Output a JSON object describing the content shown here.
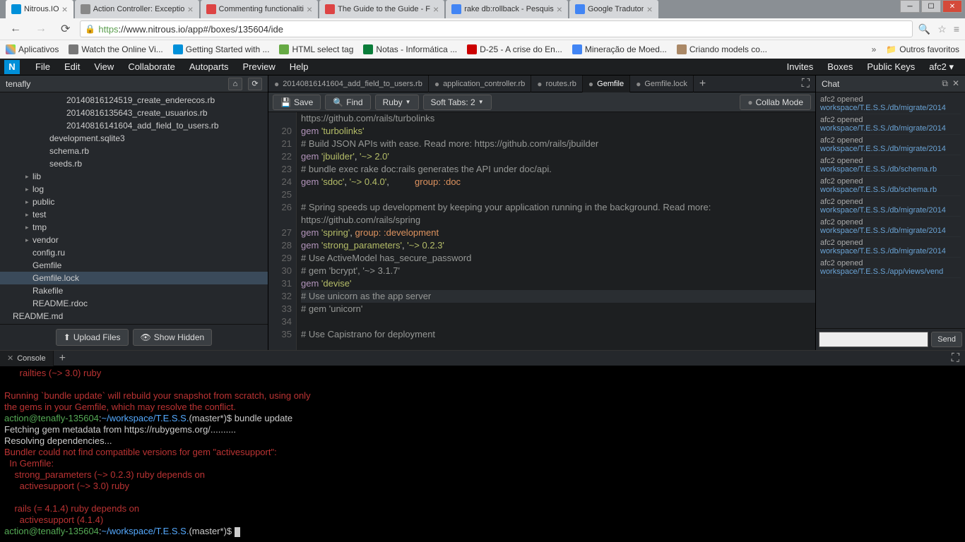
{
  "browser": {
    "tabs": [
      {
        "title": "Nitrous.IO",
        "favicon": "#0090d9",
        "active": true
      },
      {
        "title": "Action Controller: Exceptio",
        "favicon": "#888"
      },
      {
        "title": "Commenting functionaliti",
        "favicon": "#d44"
      },
      {
        "title": "The Guide to the Guide - F",
        "favicon": "#d44"
      },
      {
        "title": "rake db:rollback - Pesquis",
        "favicon": "#4285f4"
      },
      {
        "title": "Google Tradutor",
        "favicon": "#4285f4"
      }
    ],
    "url_https": "https",
    "url_rest": "://www.nitrous.io/app#/boxes/135604/ide",
    "bookmarks_label": "Aplicativos",
    "bookmarks": [
      {
        "label": "Watch the Online Vi...",
        "color": "#777"
      },
      {
        "label": "Getting Started with ...",
        "color": "#0090d9"
      },
      {
        "label": "HTML select tag",
        "color": "#6a4"
      },
      {
        "label": "Notas - Informática ...",
        "color": "#0a7d3a"
      },
      {
        "label": "D-25 - A crise do En...",
        "color": "#c00"
      },
      {
        "label": "Mineração de Moed...",
        "color": "#4285f4"
      },
      {
        "label": "Criando models co...",
        "color": "#a86"
      }
    ],
    "other_bookmarks": "Outros favoritos"
  },
  "menubar": {
    "items": [
      "File",
      "Edit",
      "View",
      "Collaborate",
      "Autoparts",
      "Preview",
      "Help"
    ],
    "right": [
      "Invites",
      "Boxes",
      "Public Keys",
      "afc2 ▾"
    ]
  },
  "sidebar": {
    "title": "tenafly",
    "tree": [
      {
        "label": "20140816124519_create_enderecos.rb",
        "depth": 3
      },
      {
        "label": "20140816135643_create_usuarios.rb",
        "depth": 3
      },
      {
        "label": "20140816141604_add_field_to_users.rb",
        "depth": 3
      },
      {
        "label": "development.sqlite3",
        "depth": 2
      },
      {
        "label": "schema.rb",
        "depth": 2
      },
      {
        "label": "seeds.rb",
        "depth": 2
      },
      {
        "label": "lib",
        "depth": 1,
        "folder": true
      },
      {
        "label": "log",
        "depth": 1,
        "folder": true
      },
      {
        "label": "public",
        "depth": 1,
        "folder": true
      },
      {
        "label": "test",
        "depth": 1,
        "folder": true
      },
      {
        "label": "tmp",
        "depth": 1,
        "folder": true
      },
      {
        "label": "vendor",
        "depth": 1,
        "folder": true
      },
      {
        "label": "config.ru",
        "depth": 1
      },
      {
        "label": "Gemfile",
        "depth": 1
      },
      {
        "label": "Gemfile.lock",
        "depth": 1,
        "selected": true
      },
      {
        "label": "Rakefile",
        "depth": 1
      },
      {
        "label": "README.rdoc",
        "depth": 1
      },
      {
        "label": "README.md",
        "depth": 0
      }
    ],
    "upload": "Upload Files",
    "show_hidden": "Show Hidden"
  },
  "editor": {
    "tabs": [
      {
        "label": "20140816141604_add_field_to_users.rb",
        "dirty": true
      },
      {
        "label": "application_controller.rb",
        "dirty": true
      },
      {
        "label": "routes.rb",
        "dirty": true
      },
      {
        "label": "Gemfile",
        "dirty": true,
        "active": true
      },
      {
        "label": "Gemfile.lock",
        "dirty": true
      }
    ],
    "save": "Save",
    "find": "Find",
    "lang": "Ruby",
    "softtabs": "Soft Tabs: 2",
    "collab": "Collab Mode",
    "gutter": [
      "",
      "20",
      "21",
      "22",
      "23",
      "24",
      "25",
      "26",
      "",
      "27",
      "28",
      "29",
      "30",
      "31",
      "32",
      "33",
      "34",
      "35"
    ],
    "code_html": [
      "<span class='c-cm'>https://github.com/rails/turbolinks</span>",
      "<span class='c-kw'>gem</span> <span class='c-str'>'turbolinks'</span>",
      "<span class='c-cm'># Build JSON APIs with ease. Read more: https://github.com/rails/jbuilder</span>",
      "<span class='c-kw'>gem</span> <span class='c-str'>'jbuilder'</span>, <span class='c-str'>'~> 2.0'</span>",
      "<span class='c-cm'># bundle exec rake doc:rails generates the API under doc/api.</span>",
      "<span class='c-kw'>gem</span> <span class='c-str'>'sdoc'</span>, <span class='c-str'>'~> 0.4.0'</span>,          <span class='c-sym'>group: :doc</span>",
      "",
      "<span class='c-cm'># Spring speeds up development by keeping your application running in the background. Read more:</span>",
      "<span class='c-cm'>https://github.com/rails/spring</span>",
      "<span class='c-kw'>gem</span> <span class='c-str'>'spring'</span>, <span class='c-sym'>group: :development</span>",
      "<span class='c-kw'>gem</span> <span class='c-str'>'strong_parameters'</span>, <span class='c-str'>'~> 0.2.3'</span>",
      "<span class='c-cm'># Use ActiveModel has_secure_password</span>",
      "<span class='c-cm'># gem 'bcrypt', '~> 3.1.7'</span>",
      "<span class='c-kw'>gem</span> <span class='c-str'>'devise'</span>",
      "<span class='c-cm'># Use unicorn as the app server</span>",
      "<span class='c-cm'># gem 'unicorn'</span>",
      "",
      "<span class='c-cm'># Use Capistrano for deployment</span>"
    ],
    "highlight_line": 14
  },
  "chat": {
    "title": "Chat",
    "entries": [
      {
        "who": "afc2 opened",
        "path": "workspace/T.E.S.S./db/migrate/2014"
      },
      {
        "who": "afc2 opened",
        "path": "workspace/T.E.S.S./db/migrate/2014"
      },
      {
        "who": "afc2 opened",
        "path": "workspace/T.E.S.S./db/migrate/2014"
      },
      {
        "who": "afc2 opened",
        "path": "workspace/T.E.S.S./db/schema.rb"
      },
      {
        "who": "afc2 opened",
        "path": "workspace/T.E.S.S./db/schema.rb"
      },
      {
        "who": "afc2 opened",
        "path": "workspace/T.E.S.S./db/migrate/2014"
      },
      {
        "who": "afc2 opened",
        "path": "workspace/T.E.S.S./db/migrate/2014"
      },
      {
        "who": "afc2 opened",
        "path": "workspace/T.E.S.S./db/migrate/2014"
      },
      {
        "who": "afc2 opened",
        "path": "workspace/T.E.S.S./app/views/vend"
      }
    ],
    "send": "Send"
  },
  "console": {
    "tab": "Console",
    "lines": [
      {
        "cls": "",
        "text": "      railties (~> 3.0) ruby"
      },
      {
        "cls": "",
        "text": ""
      },
      {
        "cls": "",
        "text": "Running `bundle update` will rebuild your snapshot from scratch, using only"
      },
      {
        "cls": "",
        "text": "the gems in your Gemfile, which may resolve the conflict."
      },
      {
        "cls": "prompt",
        "text": ""
      },
      {
        "cls": "white",
        "text": "Fetching gem metadata from https://rubygems.org/.........."
      },
      {
        "cls": "white",
        "text": "Resolving dependencies..."
      },
      {
        "cls": "",
        "text": "Bundler could not find compatible versions for gem \"activesupport\":"
      },
      {
        "cls": "",
        "text": "  In Gemfile:"
      },
      {
        "cls": "",
        "text": "    strong_parameters (~> 0.2.3) ruby depends on"
      },
      {
        "cls": "",
        "text": "      activesupport (~> 3.0) ruby"
      },
      {
        "cls": "",
        "text": ""
      },
      {
        "cls": "",
        "text": "    rails (= 4.1.4) ruby depends on"
      },
      {
        "cls": "",
        "text": "      activesupport (4.1.4)"
      },
      {
        "cls": "prompt2",
        "text": ""
      }
    ],
    "prompt_user": "action@tenafly-135604",
    "prompt_path": "~/workspace/T.E.S.S.",
    "prompt_branch": "(master*)",
    "prompt_cmd": "bundle update"
  }
}
